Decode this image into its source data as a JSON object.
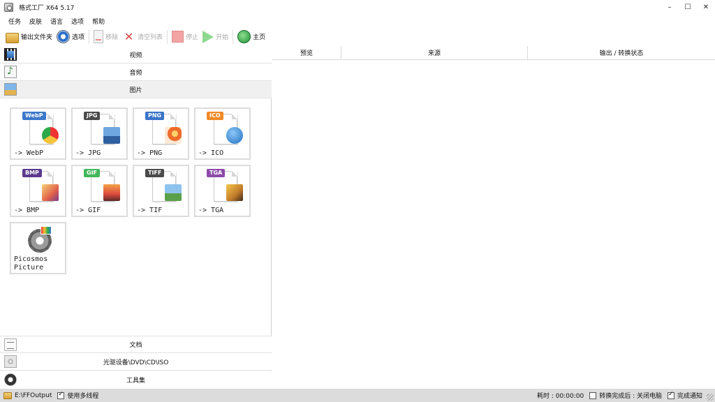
{
  "window": {
    "title": "格式工厂 X64 5.17",
    "controls": {
      "minimize": "–",
      "maximize": "☐",
      "close": "✕"
    }
  },
  "menu": [
    "任务",
    "皮肤",
    "语言",
    "选项",
    "帮助"
  ],
  "toolbar": {
    "output_folder": "输出文件夹",
    "options": "选项",
    "remove": "移除",
    "clear_list": "清空列表",
    "stop": "停止",
    "start": "开始",
    "home": "主页"
  },
  "categories": {
    "video": "视频",
    "audio": "音频",
    "image": "图片",
    "document": "文档",
    "disc": "光驱设备\\DVD\\CD\\ISO",
    "tools": "工具集"
  },
  "image_tools": [
    {
      "badge": "WebP",
      "label": "-> WebP",
      "color": "#3b78c9"
    },
    {
      "badge": "JPG",
      "label": "-> JPG",
      "color": "#4a4a4a"
    },
    {
      "badge": "PNG",
      "label": "-> PNG",
      "color": "#3a73c8"
    },
    {
      "badge": "ICO",
      "label": "-> ICO",
      "color": "#f08a28"
    },
    {
      "badge": "BMP",
      "label": "-> BMP",
      "color": "#5b3a8e"
    },
    {
      "badge": "GIF",
      "label": "-> GIF",
      "color": "#42b65a"
    },
    {
      "badge": "TIFF",
      "label": "-> TIF",
      "color": "#4a4a4a"
    },
    {
      "badge": "TGA",
      "label": "-> TGA",
      "color": "#8c4aa8"
    }
  ],
  "picosmos": {
    "line1": "Picosmos",
    "line2": "Picture"
  },
  "task_list": {
    "columns": [
      "预览",
      "来源",
      "输出 / 转换状态"
    ]
  },
  "status": {
    "output_path": "E:\\FFOutput",
    "multithread": "使用多线程",
    "elapsed": "耗时 : 00:00:00",
    "after_convert": "转换完成后 : 关闭电脑",
    "notify": "完成通知"
  }
}
